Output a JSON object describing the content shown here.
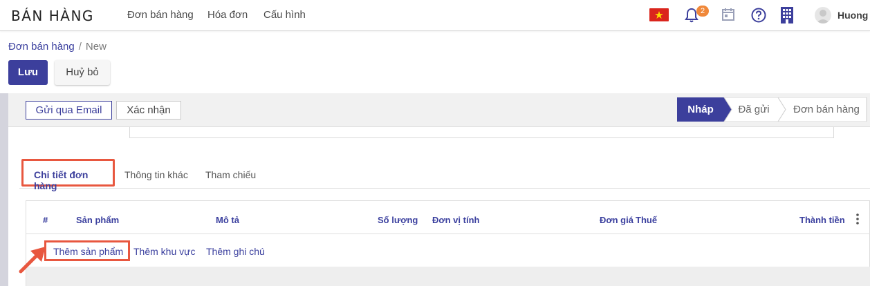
{
  "navbar": {
    "app_title": "BÁN HÀNG",
    "menu": [
      {
        "label": "Đơn bán hàng"
      },
      {
        "label": "Hóa đơn"
      },
      {
        "label": "Cấu hình"
      }
    ],
    "notification_count": "2",
    "user_name": "Huong I",
    "icons": [
      "vietnam-flag-icon",
      "bell-icon",
      "calendar-icon",
      "help-icon",
      "company-icon",
      "avatar"
    ]
  },
  "breadcrumb": {
    "parent": "Đơn bán hàng",
    "separator": "/",
    "current": "New"
  },
  "control_buttons": {
    "save": "Lưu",
    "discard": "Huỷ bỏ"
  },
  "statusbar": {
    "send_email": "Gửi qua Email",
    "confirm": "Xác nhận",
    "stages": [
      {
        "label": "Nháp",
        "active": true
      },
      {
        "label": "Đã gửi",
        "active": false
      },
      {
        "label": "Đơn bán hàng",
        "active": false
      }
    ]
  },
  "tabs": [
    {
      "label": "Chi tiết đơn hàng",
      "active": true
    },
    {
      "label": "Thông tin khác",
      "active": false
    },
    {
      "label": "Tham chiếu",
      "active": false
    }
  ],
  "order_lines": {
    "columns": [
      "#",
      "Sản phẩm",
      "Mô tả",
      "Số lượng",
      "Đơn vị tính",
      "Đơn giá",
      "Thuế",
      "Thành tiền"
    ],
    "add_links": [
      "Thêm sản phẩm",
      "Thêm khu vực",
      "Thêm ghi chú"
    ]
  },
  "colors": {
    "primary": "#3c3f9c",
    "highlight": "#e8573f",
    "badge": "#f0883a"
  }
}
